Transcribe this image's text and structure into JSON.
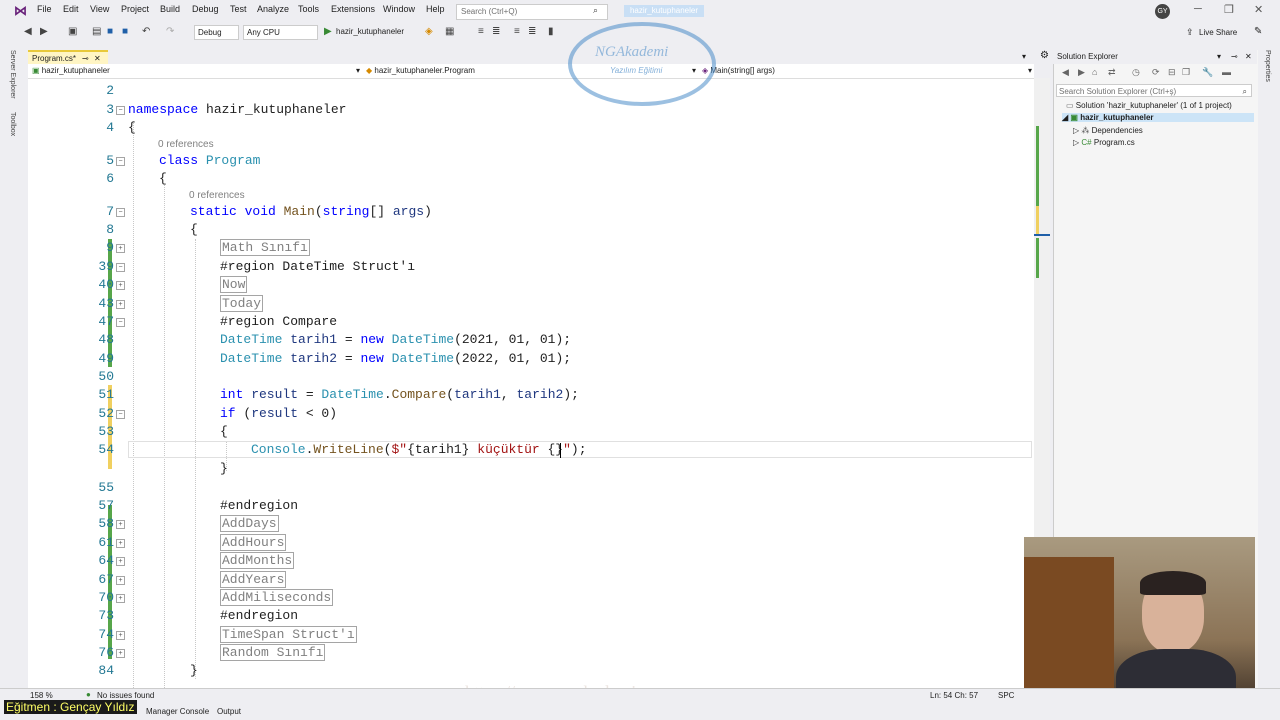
{
  "menu": {
    "items": [
      "File",
      "Edit",
      "View",
      "Project",
      "Build",
      "Debug",
      "Test",
      "Analyze",
      "Tools",
      "Extensions",
      "Window",
      "Help"
    ],
    "search_placeholder": "Search (Ctrl+Q)",
    "solution_name": "hazir_kutuphaneler",
    "avatar_initials": "GY",
    "live_share": "Live Share"
  },
  "toolbar": {
    "config": "Debug",
    "platform": "Any CPU",
    "run_target": "hazir_kutuphaneler"
  },
  "left_tabs": {
    "server_explorer": "Server Explorer",
    "toolbox": "Toolbox"
  },
  "right_tabs": {
    "properties": "Properties"
  },
  "editor": {
    "file_tab": "Program.cs*",
    "nav": {
      "project": "hazir_kutuphaneler",
      "class": "hazir_kutuphaneler.Program",
      "member": "Main(string[] args)"
    },
    "refs1": "0 references",
    "refs2": "0 references",
    "lines": [
      "2",
      "3",
      "4",
      "5",
      "6",
      "7",
      "8",
      "9",
      "39",
      "40",
      "43",
      "47",
      "48",
      "49",
      "50",
      "51",
      "52",
      "53",
      "54",
      "55",
      "57",
      "58",
      "61",
      "64",
      "67",
      "70",
      "73",
      "74",
      "76",
      "84"
    ],
    "code": {
      "ns_kw": "namespace",
      "ns_name": " hazir_kutuphaneler",
      "brace_open": "{",
      "brace_close": "}",
      "class_kw": "class",
      "class_name": " Program",
      "static_kw": "static",
      "void_kw": " void",
      "main_fn": " Main",
      "main_args_open": "(",
      "string_kw": "string",
      "main_args_rest": "[] ",
      "args_var": "args",
      "main_close": ")",
      "region_math": "Math Sınıfı",
      "region_datetime": "#region DateTime Struct'ı",
      "region_now": "Now",
      "region_today": "Today",
      "region_compare": "#region Compare",
      "l48_type": "DateTime",
      "l48_var": " tarih1",
      "l48_eq": " = ",
      "new_kw": "new",
      "l48_type2": " DateTime",
      "l48_args": "(2021, 01, 01);",
      "l49_type": "DateTime",
      "l49_var": " tarih2",
      "l49_eq": " = ",
      "l49_type2": " DateTime",
      "l49_args": "(2022, 01, 01);",
      "int_kw": "int",
      "result_var": " result",
      "l51_eq": " = ",
      "l51_type": "DateTime",
      "l51_dot": ".",
      "compare_fn": "Compare",
      "l51_open": "(",
      "l51_a1": "tarih1",
      "l51_comma": ", ",
      "l51_a2": "tarih2",
      "l51_close": ");",
      "if_kw": "if",
      "l52_open": " (",
      "l52_result": "result",
      "l52_rest": " < 0)",
      "console_type": "Console",
      "l54_dot": ".",
      "writeline_fn": "WriteLine",
      "l54_open": "(",
      "l54_str1": "$\"",
      "l54_interp1": "{tarih1}",
      "l54_str2": " küçüktür ",
      "l54_interp2": "{}",
      "l54_str3": "\"",
      "l54_close": ");",
      "endregion1": "#endregion",
      "region_adddays": "AddDays",
      "region_addhours": "AddHours",
      "region_addmonths": "AddMonths",
      "region_addyears": "AddYears",
      "region_addms": "AddMiliseconds",
      "endregion2": "#endregion",
      "region_timespan": "TimeSpan Struct'ı",
      "region_random": "Random Sınıfı"
    }
  },
  "solution_explorer": {
    "title": "Solution Explorer",
    "search_placeholder": "Search Solution Explorer (Ctrl+ş)",
    "solution": "Solution 'hazir_kutuphaneler' (1 of 1 project)",
    "project": "hazir_kutuphaneler",
    "dependencies": "Dependencies",
    "program": "Program.cs"
  },
  "status": {
    "zoom": "158 %",
    "issues": "No issues found",
    "position": "Ln: 54     Ch: 57",
    "mode": "SPC"
  },
  "bottom_tabs": {
    "manager": "Manager Console",
    "output": "Output"
  },
  "overlay": {
    "credit": "Eğitmen : Gençay Yıldız",
    "watermark": "https://www.ngakademi.com",
    "logo_title": "NGAkademi",
    "logo_sub": "Yazılım Eğitimi"
  },
  "colors": {
    "keyword": "#0000ff",
    "type": "#2b91af",
    "method": "#74531f",
    "variable": "#1f377f",
    "string": "#a31515",
    "line_number": "#237893",
    "change_bar": "#57a64a"
  }
}
